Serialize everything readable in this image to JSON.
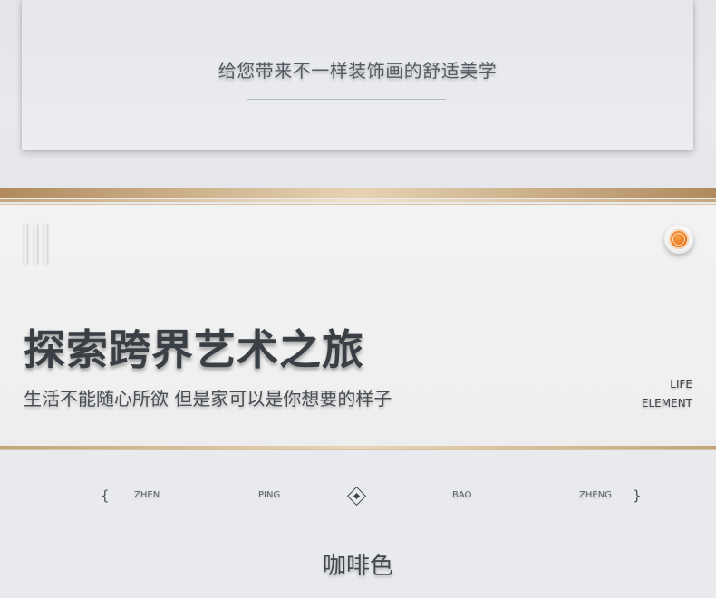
{
  "top": {
    "tagline": "给您带来不一样装饰画的舒适美学"
  },
  "hero": {
    "title": "探索跨界艺术之旅",
    "subtitle": "生活不能随心所欲 但是家可以是你想要的样子",
    "life": "LIFE",
    "element": "ELEMENT",
    "accent_color": "#e8730f"
  },
  "pinyin_row": {
    "open_brace": "{",
    "close_brace": "}",
    "words": [
      "ZHEN",
      "PING",
      "BAO",
      "ZHENG"
    ]
  },
  "color_name": "咖啡色",
  "icons": [
    "bars-icon",
    "orange-orb-icon",
    "diamond-icon"
  ]
}
